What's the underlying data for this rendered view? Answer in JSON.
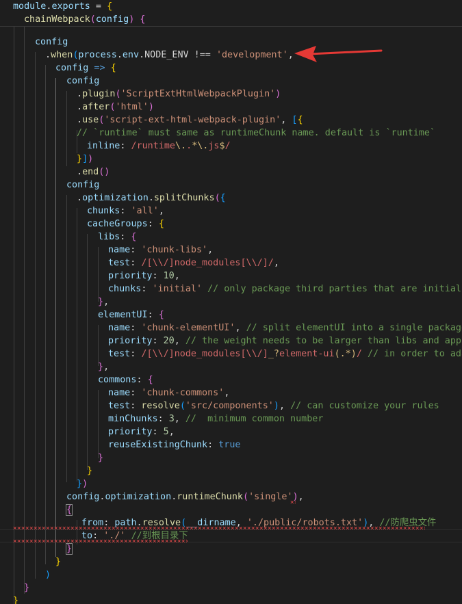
{
  "editor": {
    "language": "javascript",
    "theme": {
      "background": "#1e1e1e",
      "keyword": "#569cd6",
      "control": "#c586c0",
      "variable": "#9cdcfe",
      "function": "#dcdcaa",
      "string": "#ce9178",
      "number": "#b5cea8",
      "comment": "#6a9955",
      "bracket_gold": "#ffd700",
      "bracket_orchid": "#da70d6",
      "bracket_blue": "#179fff",
      "error_squiggle": "#f14c4c",
      "annotation_arrow": "#e53935"
    },
    "sticky": {
      "line1": {
        "a": "module",
        "b": ".",
        "c": "exports",
        "d": " = ",
        "e": "{"
      },
      "line2": {
        "a": "chainWebpack",
        "b": "(",
        "c": "config",
        "d": ") ",
        "e": "{"
      }
    },
    "lines": [
      {
        "id": "l3",
        "parts": [
          "config"
        ]
      },
      {
        "id": "l4",
        "parts": [
          ".",
          "when",
          "(",
          "process",
          ".",
          "env",
          ".",
          "NODE_ENV",
          " !== ",
          "'development'",
          ","
        ]
      },
      {
        "id": "l5",
        "parts": [
          "config",
          " => ",
          "{"
        ]
      },
      {
        "id": "l6",
        "parts": [
          "config"
        ]
      },
      {
        "id": "l7",
        "parts": [
          ".",
          "plugin",
          "(",
          "'ScriptExtHtmlWebpackPlugin'",
          ")"
        ]
      },
      {
        "id": "l8",
        "parts": [
          ".",
          "after",
          "(",
          "'html'",
          ")"
        ]
      },
      {
        "id": "l9",
        "parts": [
          ".",
          "use",
          "(",
          "'script-ext-html-webpack-plugin'",
          ", ",
          "[",
          "{"
        ]
      },
      {
        "id": "l10",
        "parts": [
          "// `runtime` must same as runtimeChunk name. default is `runtime`"
        ]
      },
      {
        "id": "l11",
        "parts": [
          "inline",
          ": ",
          "/",
          "runtime",
          "\\.",
          ".",
          "*",
          "\\.",
          "js",
          "$",
          "/"
        ]
      },
      {
        "id": "l12",
        "parts": [
          "}",
          "]",
          ")"
        ]
      },
      {
        "id": "l13",
        "parts": [
          ".",
          "end",
          "()"
        ]
      },
      {
        "id": "l14",
        "parts": [
          "config"
        ]
      },
      {
        "id": "l15",
        "parts": [
          ".",
          "optimization",
          ".",
          "splitChunks",
          "(",
          "{"
        ]
      },
      {
        "id": "l16",
        "parts": [
          "chunks",
          ": ",
          "'all'",
          ","
        ]
      },
      {
        "id": "l17",
        "parts": [
          "cacheGroups",
          ": ",
          "{"
        ]
      },
      {
        "id": "l18",
        "parts": [
          "libs",
          ": ",
          "{"
        ]
      },
      {
        "id": "l19",
        "parts": [
          "name",
          ": ",
          "'chunk-libs'",
          ","
        ]
      },
      {
        "id": "l20",
        "parts": [
          "test",
          ": ",
          "/",
          "[\\\\/]",
          "node_modules",
          "[\\\\/]",
          "/",
          ","
        ]
      },
      {
        "id": "l21",
        "parts": [
          "priority",
          ": ",
          "10",
          ","
        ]
      },
      {
        "id": "l22",
        "parts": [
          "chunks",
          ": ",
          "'initial'",
          " ",
          "// only package third parties that are initially d"
        ]
      },
      {
        "id": "l23",
        "parts": [
          "}",
          ","
        ]
      },
      {
        "id": "l24",
        "parts": [
          "elementUI",
          ": ",
          "{"
        ]
      },
      {
        "id": "l25",
        "parts": [
          "name",
          ": ",
          "'chunk-elementUI'",
          ", ",
          "// split elementUI into a single package"
        ]
      },
      {
        "id": "l26",
        "parts": [
          "priority",
          ": ",
          "20",
          ", ",
          "// the weight needs to be larger than libs and app or"
        ]
      },
      {
        "id": "l27",
        "parts": [
          "test",
          ": ",
          "/",
          "[\\\\/]",
          "node_modules",
          "[\\\\/]",
          "_?",
          "element-ui",
          "(",
          ".*",
          ")",
          "/",
          " ",
          "// in order to adapt"
        ]
      },
      {
        "id": "l28",
        "parts": [
          "}",
          ","
        ]
      },
      {
        "id": "l29",
        "parts": [
          "commons",
          ": ",
          "{"
        ]
      },
      {
        "id": "l30",
        "parts": [
          "name",
          ": ",
          "'chunk-commons'",
          ","
        ]
      },
      {
        "id": "l31",
        "parts": [
          "test",
          ": ",
          "resolve",
          "(",
          "'src/components'",
          ")",
          ", ",
          "// can customize your rules"
        ]
      },
      {
        "id": "l32",
        "parts": [
          "minChunks",
          ": ",
          "3",
          ", ",
          "//  minimum common number"
        ]
      },
      {
        "id": "l33",
        "parts": [
          "priority",
          ": ",
          "5",
          ","
        ]
      },
      {
        "id": "l34",
        "parts": [
          "reuseExistingChunk",
          ": ",
          "true"
        ]
      },
      {
        "id": "l35",
        "parts": [
          "}"
        ]
      },
      {
        "id": "l36",
        "parts": [
          "}"
        ]
      },
      {
        "id": "l37",
        "parts": [
          "}",
          ")"
        ]
      },
      {
        "id": "l38",
        "parts": [
          "config",
          ".",
          "optimization",
          ".",
          "runtimeChunk",
          "(",
          "'single'",
          ")",
          ","
        ]
      },
      {
        "id": "l39",
        "parts": [
          "{"
        ]
      },
      {
        "id": "l40",
        "parts": [
          "from",
          ": ",
          "path",
          ".",
          "resolve",
          "(",
          "__dirname",
          ", ",
          "'./public/robots.txt'",
          ")",
          ", ",
          "//防爬虫文件"
        ]
      },
      {
        "id": "l41",
        "parts": [
          "to",
          ": ",
          "'./'",
          " ",
          "//到根目录下"
        ]
      },
      {
        "id": "l42",
        "parts": [
          "}"
        ]
      },
      {
        "id": "l43",
        "parts": [
          "}"
        ]
      },
      {
        "id": "l44",
        "parts": [
          ")"
        ]
      },
      {
        "id": "l45",
        "parts": [
          "}"
        ]
      },
      {
        "id": "l46",
        "parts": [
          "}"
        ]
      }
    ]
  }
}
